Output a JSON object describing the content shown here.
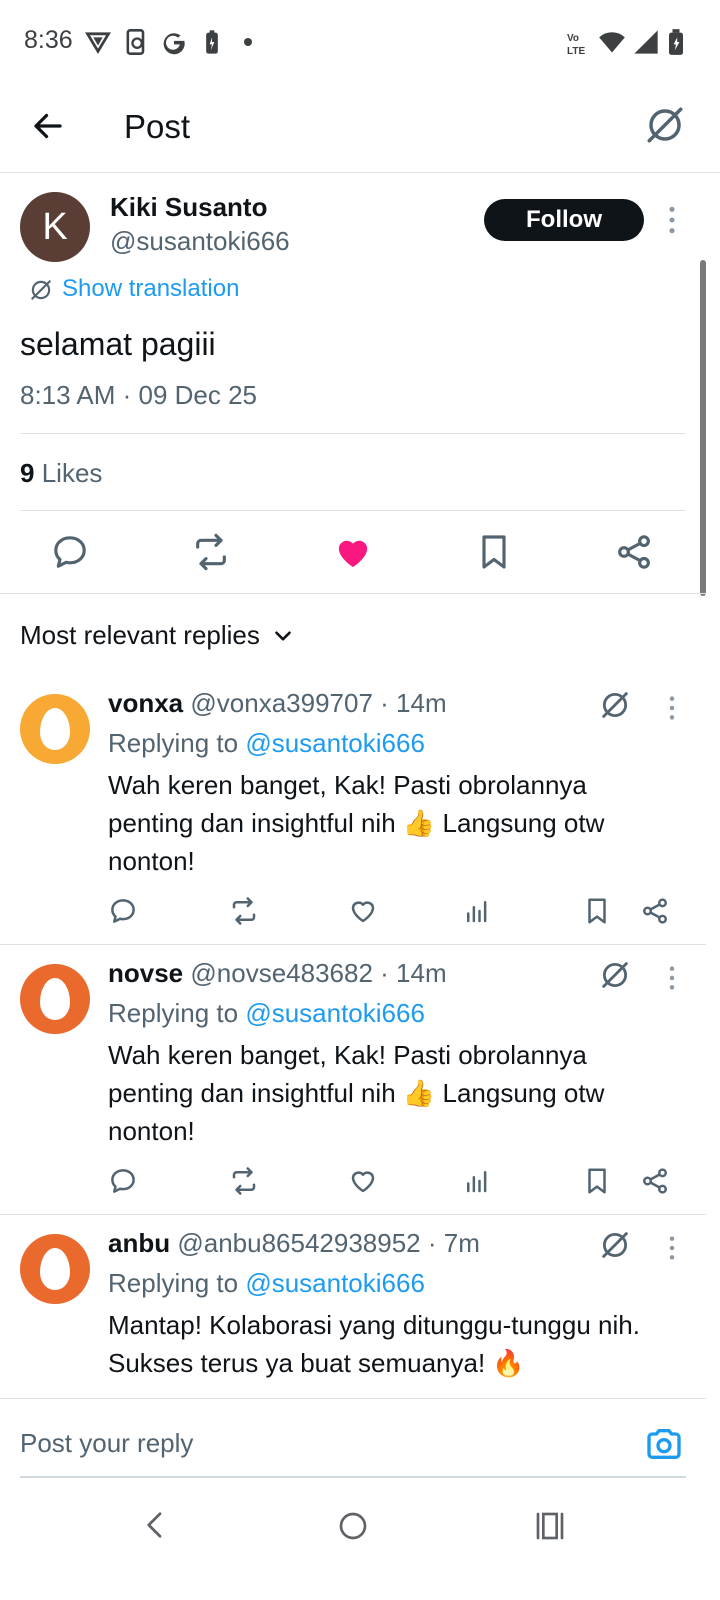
{
  "status_bar": {
    "time": "8:36"
  },
  "header": {
    "title": "Post"
  },
  "post": {
    "author": {
      "avatar_letter": "K",
      "name": "Kiki Susanto",
      "handle": "@susantoki666"
    },
    "follow_label": "Follow",
    "show_translation": "Show translation",
    "text": "selamat pagiii",
    "timestamp": "8:13 AM · 09 Dec 25",
    "likes_count": "9",
    "likes_label": "Likes",
    "liked": true,
    "colors": {
      "like_active": "#f91880",
      "link": "#1d9bf0"
    }
  },
  "replies_section": {
    "sort_label": "Most relevant replies"
  },
  "replies": [
    {
      "name": "vonxa",
      "handle": "@vonxa399707",
      "time": "· 14m",
      "replying_prefix": "Replying to",
      "replying_to": "@susantoki666",
      "text": "Wah keren banget, Kak! Pasti obrolannya penting dan insightful nih 👍 Langsung otw nonton!",
      "avatar_color": "#f7a934"
    },
    {
      "name": "novse",
      "handle": "@novse483682",
      "time": "· 14m",
      "replying_prefix": "Replying to",
      "replying_to": "@susantoki666",
      "text": "Wah keren banget, Kak! Pasti obrolannya penting dan insightful nih 👍 Langsung otw nonton!",
      "avatar_color": "#ea6a2e"
    },
    {
      "name": "anbu",
      "handle": "@anbu86542938952",
      "time": "· 7m",
      "replying_prefix": "Replying to",
      "replying_to": "@susantoki666",
      "text": "Mantap! Kolaborasi yang ditunggu-tunggu nih. Sukses terus ya buat semuanya! 🔥",
      "avatar_color": "#ea6a2e"
    }
  ],
  "composer": {
    "placeholder": "Post your reply"
  }
}
